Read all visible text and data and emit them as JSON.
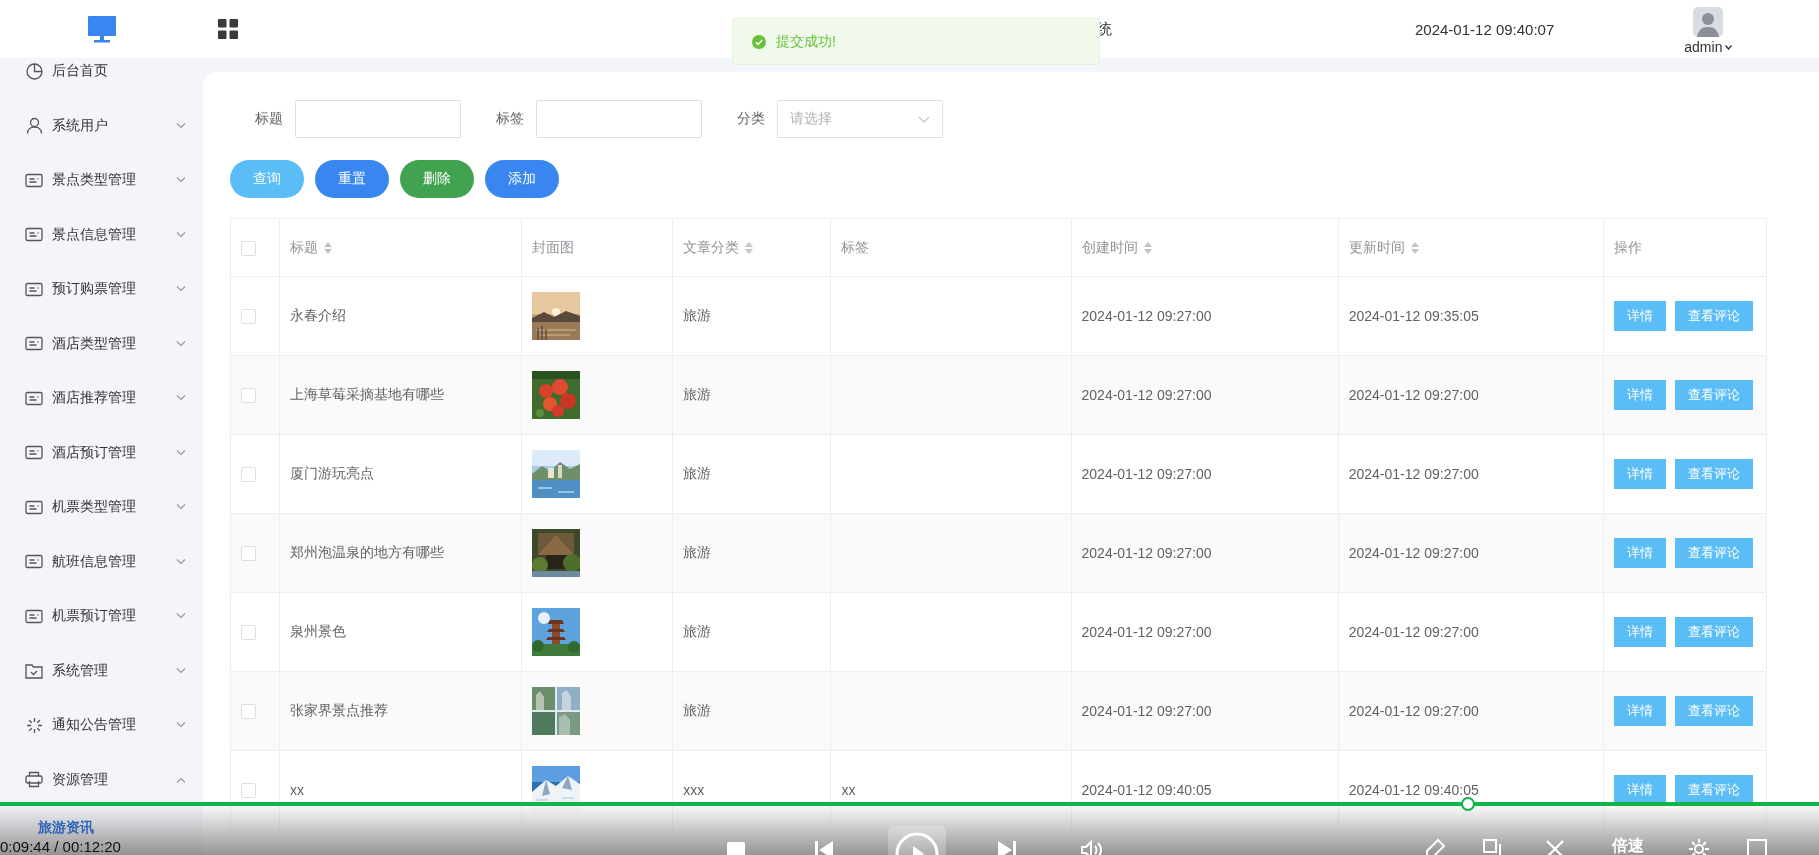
{
  "header": {
    "title_fragment": "统",
    "datetime": "2024-01-12 09:40:07",
    "user": "admin"
  },
  "toast": {
    "kind": "success",
    "message": "提交成功!"
  },
  "sidebar": {
    "items": [
      {
        "kind": "dashboard",
        "label": "后台首页"
      },
      {
        "kind": "users",
        "label": "系统用户",
        "expanded": false
      },
      {
        "kind": "module",
        "label": "景点类型管理",
        "expanded": false
      },
      {
        "kind": "module",
        "label": "景点信息管理",
        "expanded": false
      },
      {
        "kind": "module",
        "label": "预订购票管理",
        "expanded": false
      },
      {
        "kind": "module",
        "label": "酒店类型管理",
        "expanded": false
      },
      {
        "kind": "module",
        "label": "酒店推荐管理",
        "expanded": false
      },
      {
        "kind": "module",
        "label": "酒店预订管理",
        "expanded": false
      },
      {
        "kind": "module",
        "label": "机票类型管理",
        "expanded": false
      },
      {
        "kind": "module",
        "label": "航班信息管理",
        "expanded": false
      },
      {
        "kind": "module",
        "label": "机票预订管理",
        "expanded": false
      },
      {
        "kind": "settings",
        "label": "系统管理",
        "expanded": false
      },
      {
        "kind": "notice",
        "label": "通知公告管理",
        "expanded": false
      },
      {
        "kind": "resources",
        "label": "资源管理",
        "expanded": true,
        "children": [
          {
            "label": "旅游资讯",
            "selected": true
          }
        ]
      }
    ]
  },
  "filters": [
    {
      "kind": "text",
      "label": "标题"
    },
    {
      "kind": "text",
      "label": "标签"
    },
    {
      "kind": "select",
      "label": "分类",
      "placeholder": "请选择"
    }
  ],
  "buttons": [
    {
      "label": "查询",
      "color": "#5bbdf6"
    },
    {
      "label": "重置",
      "color": "#3a86f0"
    },
    {
      "label": "删除",
      "color": "#41a250"
    },
    {
      "label": "添加",
      "color": "#3a86f0"
    }
  ],
  "table": {
    "all_checked": false,
    "columns": [
      {
        "label": "标题",
        "sortable": true
      },
      {
        "label": "封面图",
        "sortable": false
      },
      {
        "label": "文章分类",
        "sortable": true
      },
      {
        "label": "标签",
        "sortable": false
      },
      {
        "label": "创建时间",
        "sortable": true
      },
      {
        "label": "更新时间",
        "sortable": true
      },
      {
        "label": "操作",
        "sortable": false
      }
    ],
    "rows": [
      {
        "checked": false,
        "title": "永春介绍",
        "category": "旅游",
        "created": "2024-01-12 09:27:00",
        "updated": "2024-01-12 09:35:05",
        "actions": [
          "详情",
          "查看评论"
        ]
      },
      {
        "checked": false,
        "title": "上海草莓采摘基地有哪些",
        "category": "旅游",
        "created": "2024-01-12 09:27:00",
        "updated": "2024-01-12 09:27:00",
        "actions": [
          "详情",
          "查看评论"
        ]
      },
      {
        "checked": false,
        "title": "厦门游玩亮点",
        "category": "旅游",
        "created": "2024-01-12 09:27:00",
        "updated": "2024-01-12 09:27:00",
        "actions": [
          "详情",
          "查看评论"
        ]
      },
      {
        "checked": false,
        "title": "郑州泡温泉的地方有哪些",
        "category": "旅游",
        "created": "2024-01-12 09:27:00",
        "updated": "2024-01-12 09:27:00",
        "actions": [
          "详情",
          "查看评论"
        ]
      },
      {
        "checked": false,
        "title": "泉州景色",
        "category": "旅游",
        "created": "2024-01-12 09:27:00",
        "updated": "2024-01-12 09:27:00",
        "actions": [
          "详情",
          "查看评论"
        ]
      },
      {
        "checked": false,
        "title": "张家界景点推荐",
        "category": "旅游",
        "created": "2024-01-12 09:27:00",
        "updated": "2024-01-12 09:27:00",
        "actions": [
          "详情",
          "查看评论"
        ]
      },
      {
        "checked": false,
        "title": "xx",
        "category": "xxx",
        "tag": "xx",
        "created": "2024-01-12 09:40:05",
        "updated": "2024-01-12 09:40:05",
        "actions": [
          "详情",
          "查看评论"
        ]
      }
    ]
  },
  "player": {
    "time": "0:09:44 / 00:12:20",
    "level": 0.807,
    "speed_label": "倍速"
  }
}
